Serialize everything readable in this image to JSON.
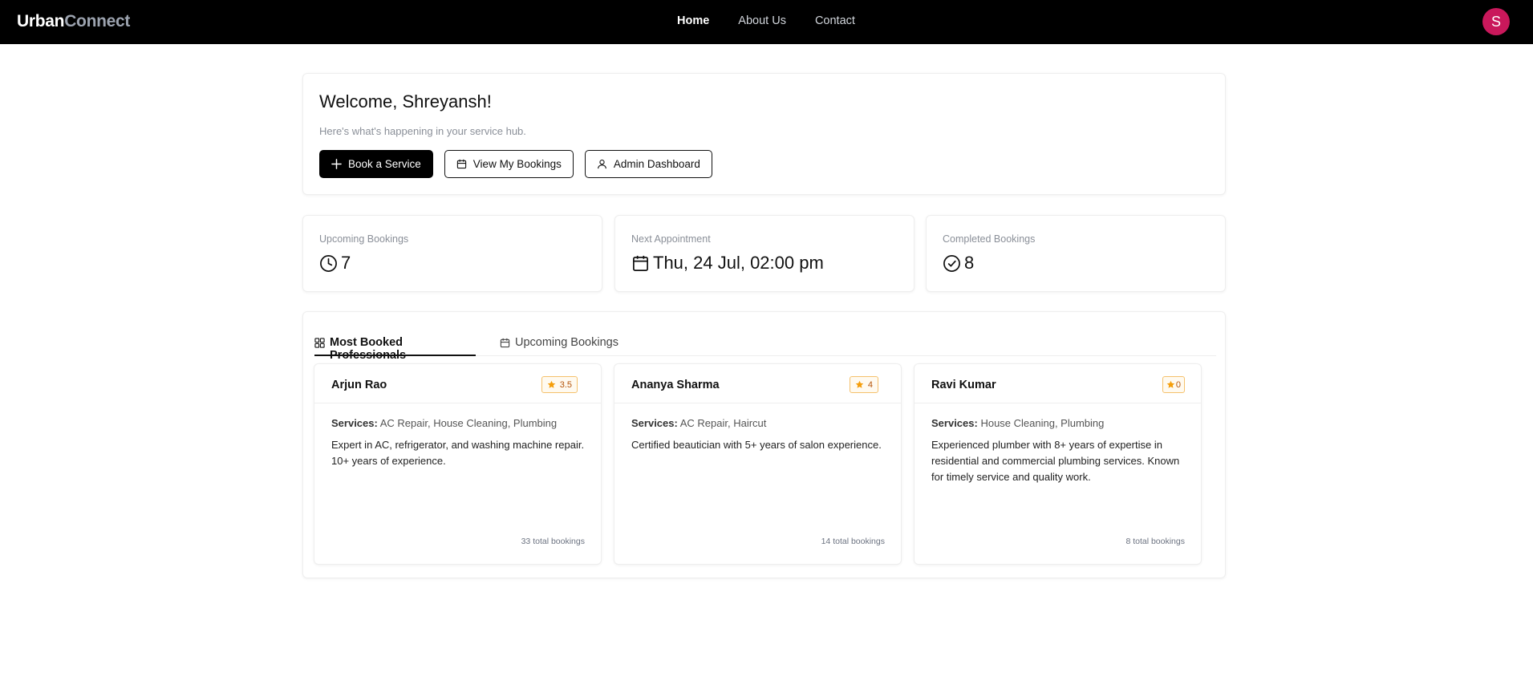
{
  "navbar": {
    "brand_part1": "Urban",
    "brand_part2": "Connect",
    "links": [
      {
        "label": "Home",
        "active": true
      },
      {
        "label": "About Us",
        "active": false
      },
      {
        "label": "Contact",
        "active": false
      }
    ],
    "avatar_letter": "S",
    "avatar_color": "#c9185b"
  },
  "welcome": {
    "title": "Welcome, Shreyansh!",
    "subtitle": "Here's what's happening in your service hub.",
    "buttons": [
      {
        "label": "Book a Service",
        "icon": "plus-icon"
      },
      {
        "label": "View My Bookings",
        "icon": "calendar-icon"
      },
      {
        "label": "Admin Dashboard",
        "icon": "user-icon"
      }
    ]
  },
  "stats": [
    {
      "label": "Upcoming Bookings",
      "value": "7",
      "icon": "clock-icon"
    },
    {
      "label": "Next Appointment",
      "value": "Thu, 24 Jul, 02:00 pm",
      "icon": "calendar-icon"
    },
    {
      "label": "Completed Bookings",
      "value": "8",
      "icon": "check-circle-icon"
    }
  ],
  "tabs": [
    {
      "label": "Most Booked Professionals",
      "icon": "grid-icon",
      "active": true
    },
    {
      "label": "Upcoming Bookings",
      "icon": "calendar-icon",
      "active": false
    }
  ],
  "services_label": "Services:",
  "professionals": [
    {
      "name": "Arjun Rao",
      "rating": "3.5",
      "services": "AC Repair, House Cleaning, Plumbing",
      "description": "Expert in AC, refrigerator, and washing machine repair. 10+ years of experience.",
      "total_bookings": "33 total bookings"
    },
    {
      "name": "Ananya Sharma",
      "rating": "4",
      "services": "AC Repair, Haircut",
      "description": "Certified beautician with 5+ years of salon experience.",
      "total_bookings": "14 total bookings"
    },
    {
      "name": "Ravi Kumar",
      "rating": "0",
      "services": "House Cleaning, Plumbing",
      "description": "Experienced plumber with 8+ years of expertise in residential and commercial plumbing services. Known for timely service and quality work.",
      "total_bookings": "8 total bookings"
    }
  ],
  "colors": {
    "rating_star": "#f59e0b",
    "rating_border": "#f5c16c",
    "navbar_bg": "#000000"
  }
}
